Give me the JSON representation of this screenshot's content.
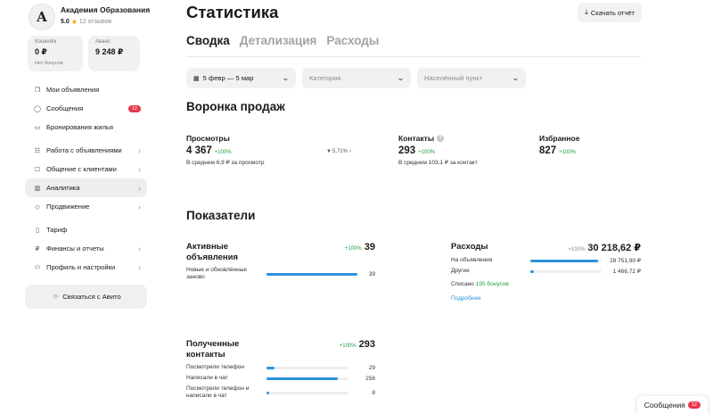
{
  "profile": {
    "avatar_letter": "A",
    "name": "Академия Образования",
    "rating": "5.0",
    "reviews": "12 отзывов"
  },
  "wallets": [
    {
      "caption": "Кошелёк",
      "value": "0 ₽",
      "note": "Нет бонусов"
    },
    {
      "caption": "Аванс",
      "value": "9 248 ₽",
      "note": ""
    }
  ],
  "nav": {
    "group1": [
      {
        "icon": "copy-icon",
        "glyph": "❐",
        "label": "Мои объявления",
        "badge": "",
        "chevron": false,
        "active": false
      },
      {
        "icon": "chat-icon",
        "glyph": "◯",
        "label": "Сообщения",
        "badge": "12",
        "chevron": false,
        "active": false
      },
      {
        "icon": "bed-icon",
        "glyph": "▭",
        "label": "Бронирования жилья",
        "badge": "",
        "chevron": false,
        "active": false
      }
    ],
    "group2": [
      {
        "icon": "list-icon",
        "glyph": "☷",
        "label": "Работа с объявлениями",
        "badge": "",
        "chevron": true,
        "active": false
      },
      {
        "icon": "clients-icon",
        "glyph": "☐",
        "label": "Общение с клиентами",
        "badge": "",
        "chevron": true,
        "active": false
      },
      {
        "icon": "chart-icon",
        "glyph": "▥",
        "label": "Аналитика",
        "badge": "",
        "chevron": true,
        "active": true
      },
      {
        "icon": "promo-icon",
        "glyph": "◇",
        "label": "Продвижение",
        "badge": "",
        "chevron": true,
        "active": false
      }
    ],
    "group3": [
      {
        "icon": "tariff-icon",
        "glyph": "▯",
        "label": "Тариф",
        "badge": "",
        "chevron": false,
        "active": false
      },
      {
        "icon": "ruble-icon",
        "glyph": "₽",
        "label": "Финансы и отчеты",
        "badge": "",
        "chevron": true,
        "active": false
      },
      {
        "icon": "user-icon",
        "glyph": "⚇",
        "label": "Профиль и настройки",
        "badge": "",
        "chevron": true,
        "active": false
      }
    ],
    "contact_label": "Связаться с Авито"
  },
  "header": {
    "title": "Статистика",
    "download_label": "Скачать отчёт"
  },
  "tabs": [
    "Сводка",
    "Детализация",
    "Расходы"
  ],
  "filters": {
    "period": "5 февр — 5 мар",
    "category": "Категория",
    "location": "Населённый пункт"
  },
  "funnel": {
    "title": "Воронка продаж",
    "views": {
      "label": "Просмотры",
      "value": "4 367",
      "growth": "+100%",
      "sub": "В среднем 6,9 ₽ за просмотр"
    },
    "conversion": "5,71%",
    "contacts": {
      "label": "Контакты",
      "value": "293",
      "growth": "+100%",
      "sub": "В среднем 103,1 ₽ за контакт"
    },
    "favorites": {
      "label": "Избранное",
      "value": "827",
      "growth": "+100%"
    }
  },
  "indicators": {
    "title": "Показатели",
    "active_ads": {
      "title": "Активные объявления",
      "growth": "+100%",
      "value": "39",
      "rows": [
        {
          "label": "Новые и обновлённые заново",
          "value": "39",
          "fraction": 1.0
        }
      ]
    },
    "expenses": {
      "title": "Расходы",
      "growth": "+100%",
      "value": "30 218,62 ₽",
      "rows": [
        {
          "label": "На объявления",
          "value": "28 751,90 ₽",
          "fraction": 0.95
        },
        {
          "label": "Другие",
          "value": "1 466,72 ₽",
          "fraction": 0.05
        }
      ],
      "bonus_prefix": "Списано",
      "bonus_value": "195 бонусов",
      "more_link": "Подробнее"
    },
    "received_contacts": {
      "title": "Полученные контакты",
      "growth": "+100%",
      "value": "293",
      "rows": [
        {
          "label": "Посмотрели телефон",
          "value": "29",
          "fraction": 0.1
        },
        {
          "label": "Написали в чат",
          "value": "256",
          "fraction": 0.87
        },
        {
          "label": "Посмотрели телефон и написали в чат",
          "value": "8",
          "fraction": 0.03
        }
      ]
    }
  },
  "toast": {
    "label": "Сообщения",
    "badge": "12"
  },
  "colors": {
    "accent": "#2a93d9",
    "growth": "#1f9e3b",
    "badge": "#e8364a",
    "card": "#f2f1ef"
  }
}
